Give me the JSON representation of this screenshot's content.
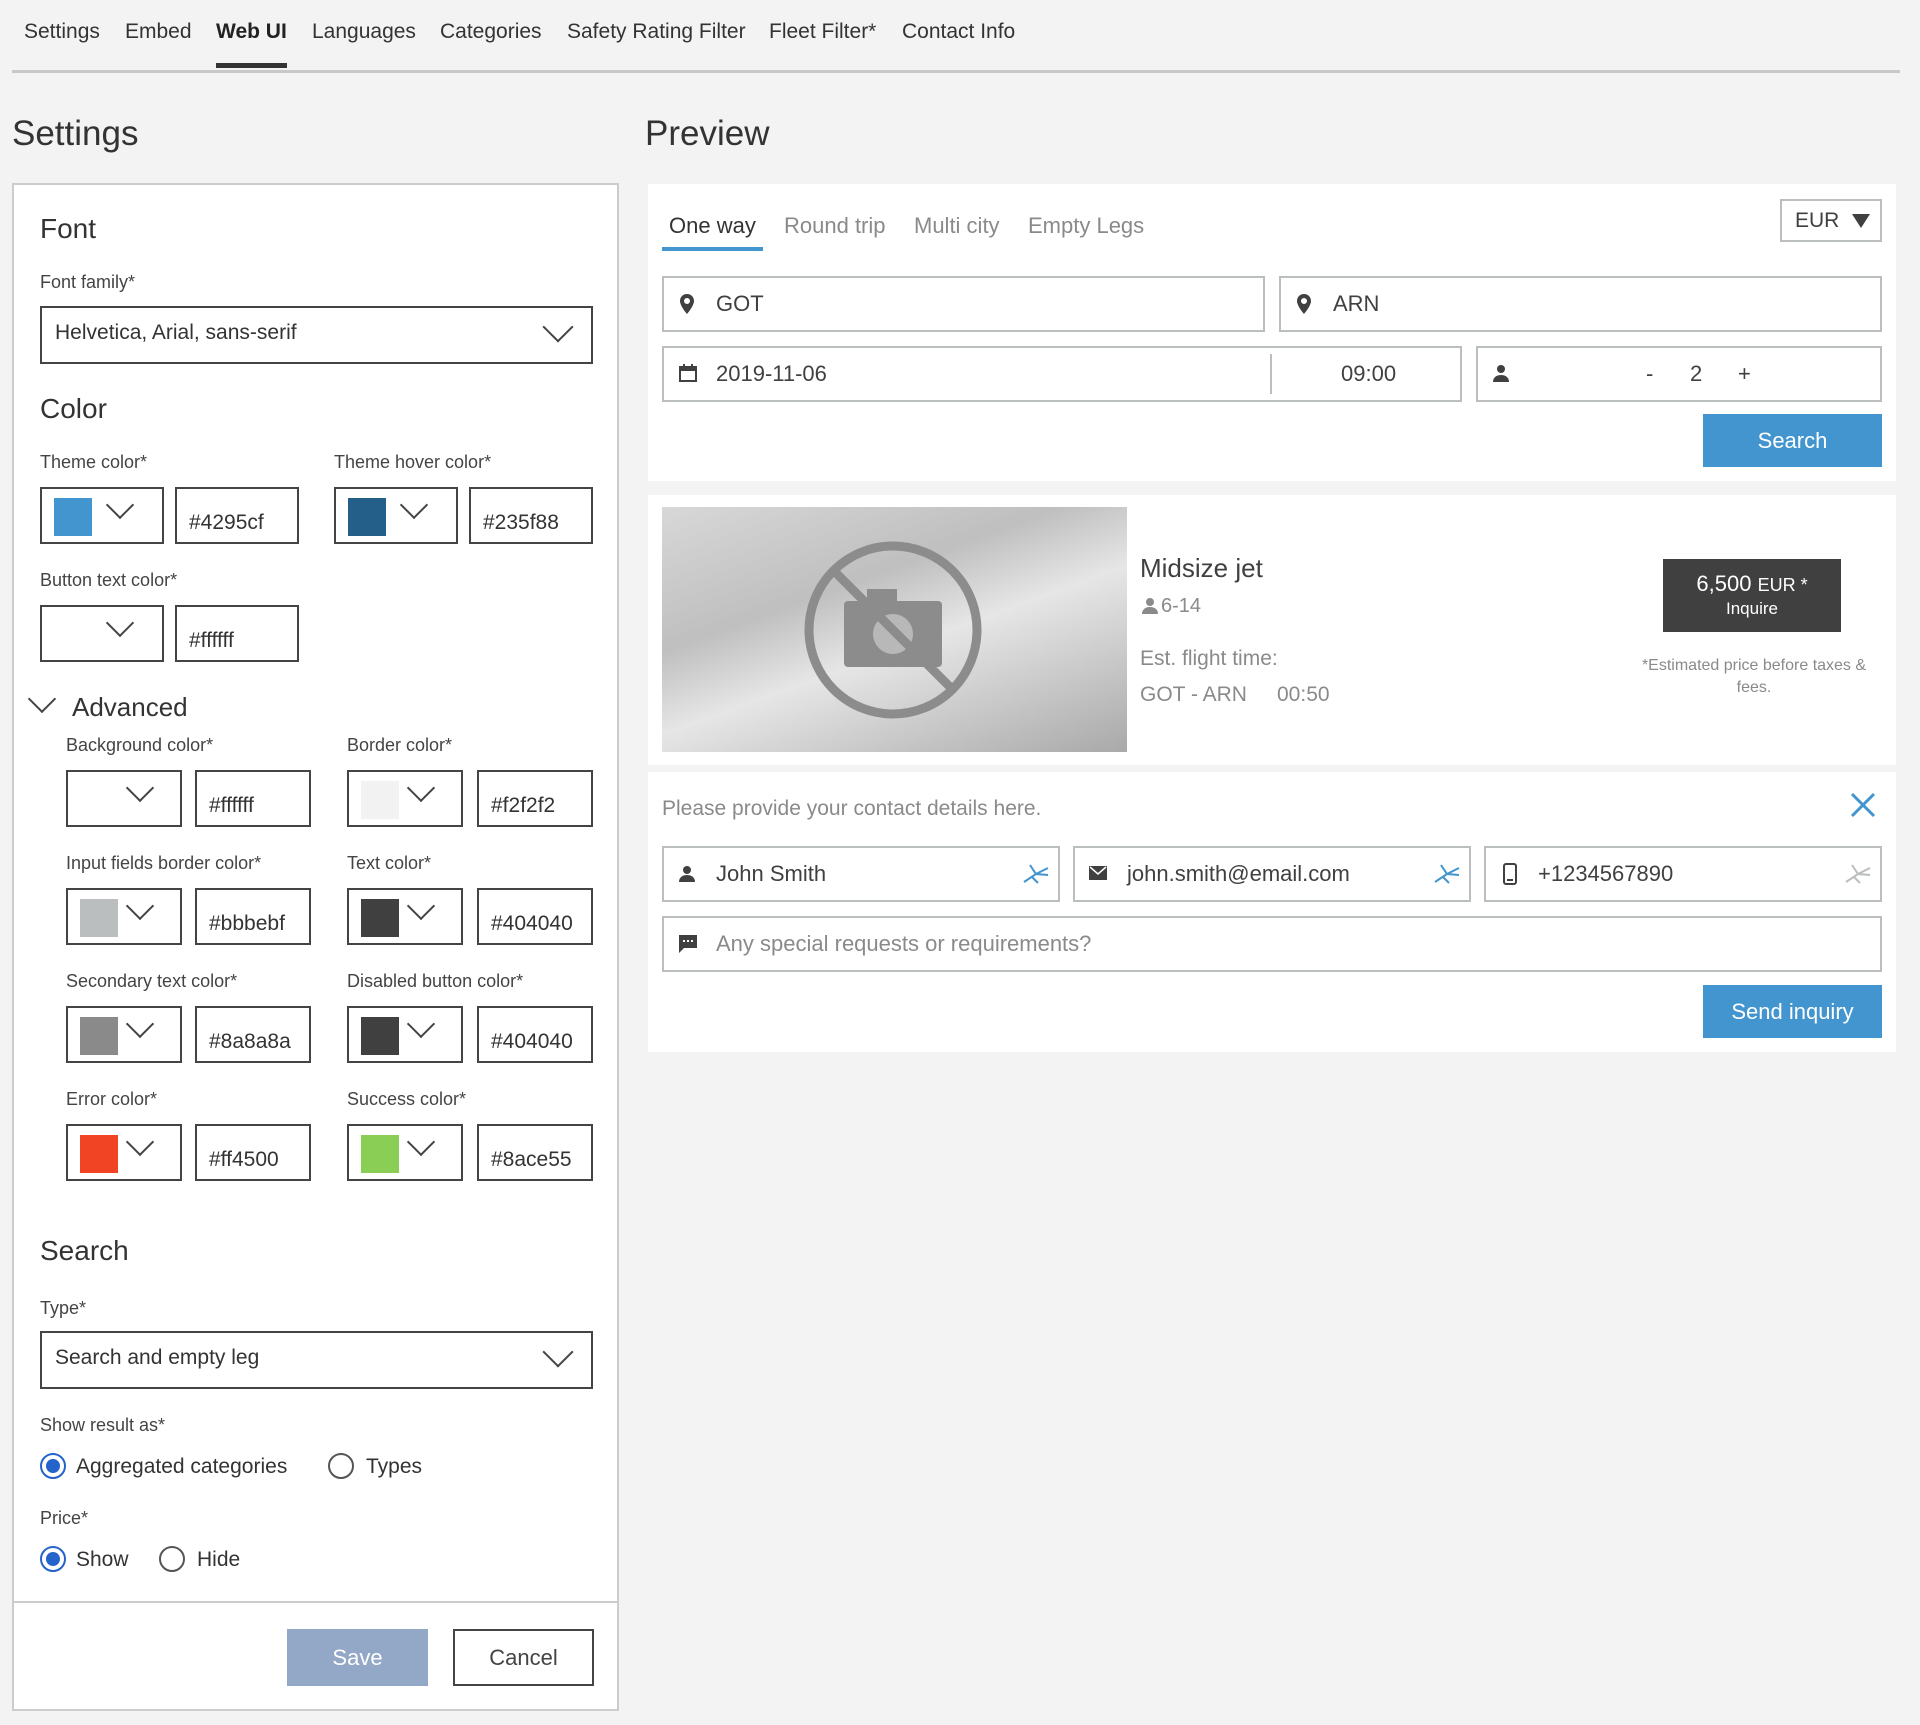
{
  "tabs": [
    "Settings",
    "Embed",
    "Web UI",
    "Languages",
    "Categories",
    "Safety Rating Filter",
    "Fleet Filter*",
    "Contact Info"
  ],
  "headings": {
    "settings": "Settings",
    "preview": "Preview"
  },
  "font": {
    "title": "Font",
    "family_label": "Font family*",
    "family_value": "Helvetica, Arial, sans-serif"
  },
  "color": {
    "title": "Color",
    "theme_label": "Theme color*",
    "theme_value": "#4295cf",
    "theme_hover_label": "Theme hover color*",
    "theme_hover_value": "#235f88",
    "button_text_label": "Button text color*",
    "button_text_value": "#ffffff"
  },
  "advanced": {
    "title": "Advanced",
    "background_label": "Background color*",
    "background_value": "#ffffff",
    "border_label": "Border color*",
    "border_value": "#f2f2f2",
    "input_border_label": "Input fields border color*",
    "input_border_value": "#bbbebf",
    "text_label": "Text color*",
    "text_value": "#404040",
    "secondary_label": "Secondary text color*",
    "secondary_value": "#8a8a8a",
    "disabled_label": "Disabled button color*",
    "disabled_value": "#404040",
    "error_label": "Error color*",
    "error_value": "#ff4500",
    "success_label": "Success color*",
    "success_value": "#8ace55"
  },
  "search": {
    "title": "Search",
    "type_label": "Type*",
    "type_value": "Search and empty leg",
    "show_result_label": "Show result as*",
    "opt_aggregated": "Aggregated categories",
    "opt_types": "Types",
    "price_label": "Price*",
    "opt_show": "Show",
    "opt_hide": "Hide"
  },
  "actions": {
    "save": "Save",
    "cancel": "Cancel"
  },
  "preview": {
    "trip_tabs": [
      "One way",
      "Round trip",
      "Multi city",
      "Empty Legs"
    ],
    "currency": "EUR",
    "from": "GOT",
    "to": "ARN",
    "date": "2019-11-06",
    "time": "09:00",
    "pax_minus": "-",
    "pax_count": "2",
    "pax_plus": "+",
    "search_button": "Search",
    "result": {
      "name": "Midsize jet",
      "capacity": "6-14",
      "est_label": "Est. flight time:",
      "route": "GOT - ARN",
      "duration": "00:50",
      "price": "6,500",
      "price_currency": "EUR *",
      "inquire": "Inquire",
      "note": "*Estimated price before taxes & fees."
    },
    "contact": {
      "prompt": "Please provide your contact details here.",
      "name": "John Smith",
      "email": "john.smith@email.com",
      "phone": "+1234567890",
      "requests_placeholder": "Any special requests or requirements?",
      "send_button": "Send inquiry"
    }
  }
}
